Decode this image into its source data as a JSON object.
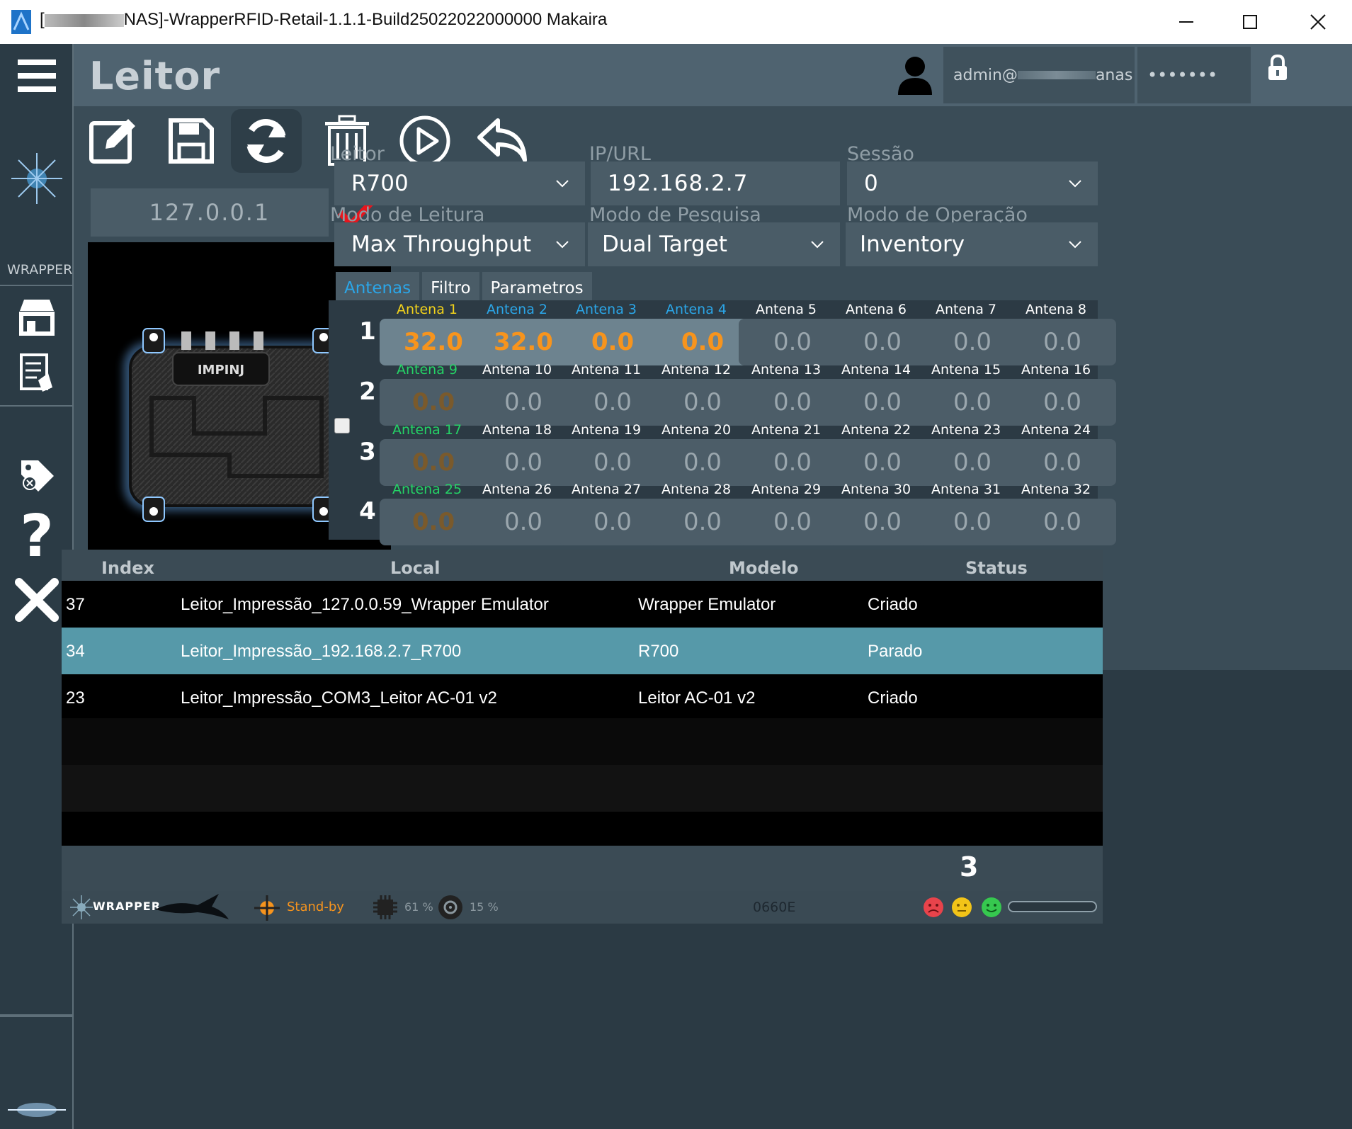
{
  "window": {
    "title_prefix": "[",
    "title": "NAS]-WrapperRFID-Retail-1.1.1-Build25022022000000 Makaira"
  },
  "sidebar": {
    "wrapper_label": "WRAPPER"
  },
  "header": {
    "page_title": "Leitor",
    "user_prefix": "admin@",
    "user_suffix": "anas",
    "password_mask": "•••••••"
  },
  "toolbar": {
    "items": [
      "edit-icon",
      "save-icon",
      "refresh-icon",
      "delete-icon",
      "play-icon",
      "undo-icon"
    ]
  },
  "reader_panel": {
    "ip": "127.0.0.1",
    "brand": "IMPINJ"
  },
  "form": {
    "leitor_label": "Leitor",
    "leitor_value": "R700",
    "ip_label": "IP/URL",
    "ip_value": "192.168.2.7",
    "sessao_label": "Sessão",
    "sessao_value": "0",
    "modo_leitura_label": "Modo de Leitura",
    "modo_leitura_value": "Max Throughput",
    "modo_pesquisa_label": "Modo de Pesquisa",
    "modo_pesquisa_value": "Dual Target",
    "modo_operacao_label": "Modo de Operação",
    "modo_operacao_value": "Inventory"
  },
  "tabs": [
    "Antenas",
    "Filtro",
    "Parametros"
  ],
  "antennas": {
    "rows": [
      {
        "num": "1",
        "cells": [
          {
            "label": "Antena 1",
            "value": "32.0",
            "state": "on",
            "color": "#f2d21b"
          },
          {
            "label": "Antena 2",
            "value": "32.0",
            "state": "on",
            "color": "#2ba6e8"
          },
          {
            "label": "Antena 3",
            "value": "0.0",
            "state": "on",
            "color": "#2ba6e8"
          },
          {
            "label": "Antena 4",
            "value": "0.0",
            "state": "on",
            "color": "#2ba6e8"
          },
          {
            "label": "Antena 5",
            "value": "0.0",
            "state": "off",
            "color": "#ffffff"
          },
          {
            "label": "Antena 6",
            "value": "0.0",
            "state": "off",
            "color": "#ffffff"
          },
          {
            "label": "Antena 7",
            "value": "0.0",
            "state": "off",
            "color": "#ffffff"
          },
          {
            "label": "Antena 8",
            "value": "0.0",
            "state": "off",
            "color": "#ffffff"
          }
        ]
      },
      {
        "num": "2",
        "cells": [
          {
            "label": "Antena 9",
            "value": "0.0",
            "state": "dim",
            "color": "#25d366"
          },
          {
            "label": "Antena 10",
            "value": "0.0",
            "state": "off",
            "color": "#ffffff"
          },
          {
            "label": "Antena 11",
            "value": "0.0",
            "state": "off",
            "color": "#ffffff"
          },
          {
            "label": "Antena 12",
            "value": "0.0",
            "state": "off",
            "color": "#ffffff"
          },
          {
            "label": "Antena 13",
            "value": "0.0",
            "state": "off",
            "color": "#ffffff"
          },
          {
            "label": "Antena 14",
            "value": "0.0",
            "state": "off",
            "color": "#ffffff"
          },
          {
            "label": "Antena 15",
            "value": "0.0",
            "state": "off",
            "color": "#ffffff"
          },
          {
            "label": "Antena 16",
            "value": "0.0",
            "state": "off",
            "color": "#ffffff"
          }
        ]
      },
      {
        "num": "3",
        "cells": [
          {
            "label": "Antena 17",
            "value": "0.0",
            "state": "dim",
            "color": "#25d366"
          },
          {
            "label": "Antena 18",
            "value": "0.0",
            "state": "off",
            "color": "#ffffff"
          },
          {
            "label": "Antena 19",
            "value": "0.0",
            "state": "off",
            "color": "#ffffff"
          },
          {
            "label": "Antena 20",
            "value": "0.0",
            "state": "off",
            "color": "#ffffff"
          },
          {
            "label": "Antena 21",
            "value": "0.0",
            "state": "off",
            "color": "#ffffff"
          },
          {
            "label": "Antena 22",
            "value": "0.0",
            "state": "off",
            "color": "#ffffff"
          },
          {
            "label": "Antena 23",
            "value": "0.0",
            "state": "off",
            "color": "#ffffff"
          },
          {
            "label": "Antena 24",
            "value": "0.0",
            "state": "off",
            "color": "#ffffff"
          }
        ]
      },
      {
        "num": "4",
        "cells": [
          {
            "label": "Antena 25",
            "value": "0.0",
            "state": "dim",
            "color": "#25d366"
          },
          {
            "label": "Antena 26",
            "value": "0.0",
            "state": "off",
            "color": "#ffffff"
          },
          {
            "label": "Antena 27",
            "value": "0.0",
            "state": "off",
            "color": "#ffffff"
          },
          {
            "label": "Antena 28",
            "value": "0.0",
            "state": "off",
            "color": "#ffffff"
          },
          {
            "label": "Antena 29",
            "value": "0.0",
            "state": "off",
            "color": "#ffffff"
          },
          {
            "label": "Antena 30",
            "value": "0.0",
            "state": "off",
            "color": "#ffffff"
          },
          {
            "label": "Antena 31",
            "value": "0.0",
            "state": "off",
            "color": "#ffffff"
          },
          {
            "label": "Antena 32",
            "value": "0.0",
            "state": "off",
            "color": "#ffffff"
          }
        ]
      }
    ]
  },
  "table": {
    "headers": [
      "Index",
      "Local",
      "Modelo",
      "Status"
    ],
    "rows": [
      {
        "index": "37",
        "local": "Leitor_Impressão_127.0.0.59_Wrapper Emulator",
        "modelo": "Wrapper Emulator",
        "status": "Criado",
        "selected": false
      },
      {
        "index": "34",
        "local": "Leitor_Impressão_192.168.2.7_R700",
        "modelo": "R700",
        "status": "Parado",
        "selected": true
      },
      {
        "index": "23",
        "local": "Leitor_Impressão_COM3_Leitor AC-01 v2",
        "modelo": "Leitor AC-01 v2",
        "status": "Criado",
        "selected": false
      }
    ],
    "count": "3"
  },
  "statusbar": {
    "brand": "WRAPPER",
    "state": "Stand-by",
    "cpu": "61 %",
    "disk": "15 %",
    "code": "0660E"
  },
  "colors": {
    "accent_blue": "#2ba6e8",
    "selected_row": "#5699a9",
    "orange_value": "#f7941d",
    "status_orange": "#f7941d"
  }
}
